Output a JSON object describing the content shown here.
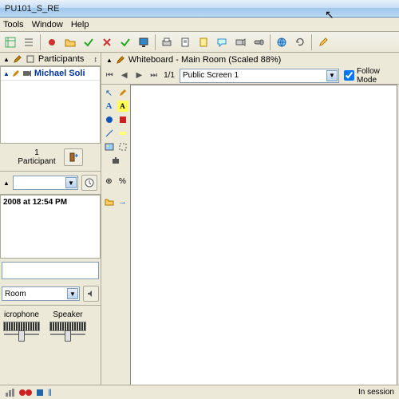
{
  "window": {
    "title": "PU101_S_RE"
  },
  "menu": {
    "tools": "Tools",
    "window": "Window",
    "help": "Help"
  },
  "participants": {
    "header": "Participants",
    "user": "Michael Soli",
    "count_num": "1",
    "count_label": "Participant"
  },
  "chat": {
    "timestamp": "2008 at 12:54 PM",
    "room_label": "Room"
  },
  "audio": {
    "mic_label": "icrophone",
    "spk_label": "Speaker"
  },
  "whiteboard": {
    "title": "Whiteboard - Main Room (Scaled 88%)",
    "page": "1/1",
    "screen": "Public Screen 1",
    "follow_label": "Follow Mode"
  },
  "status": {
    "right": "In session"
  }
}
